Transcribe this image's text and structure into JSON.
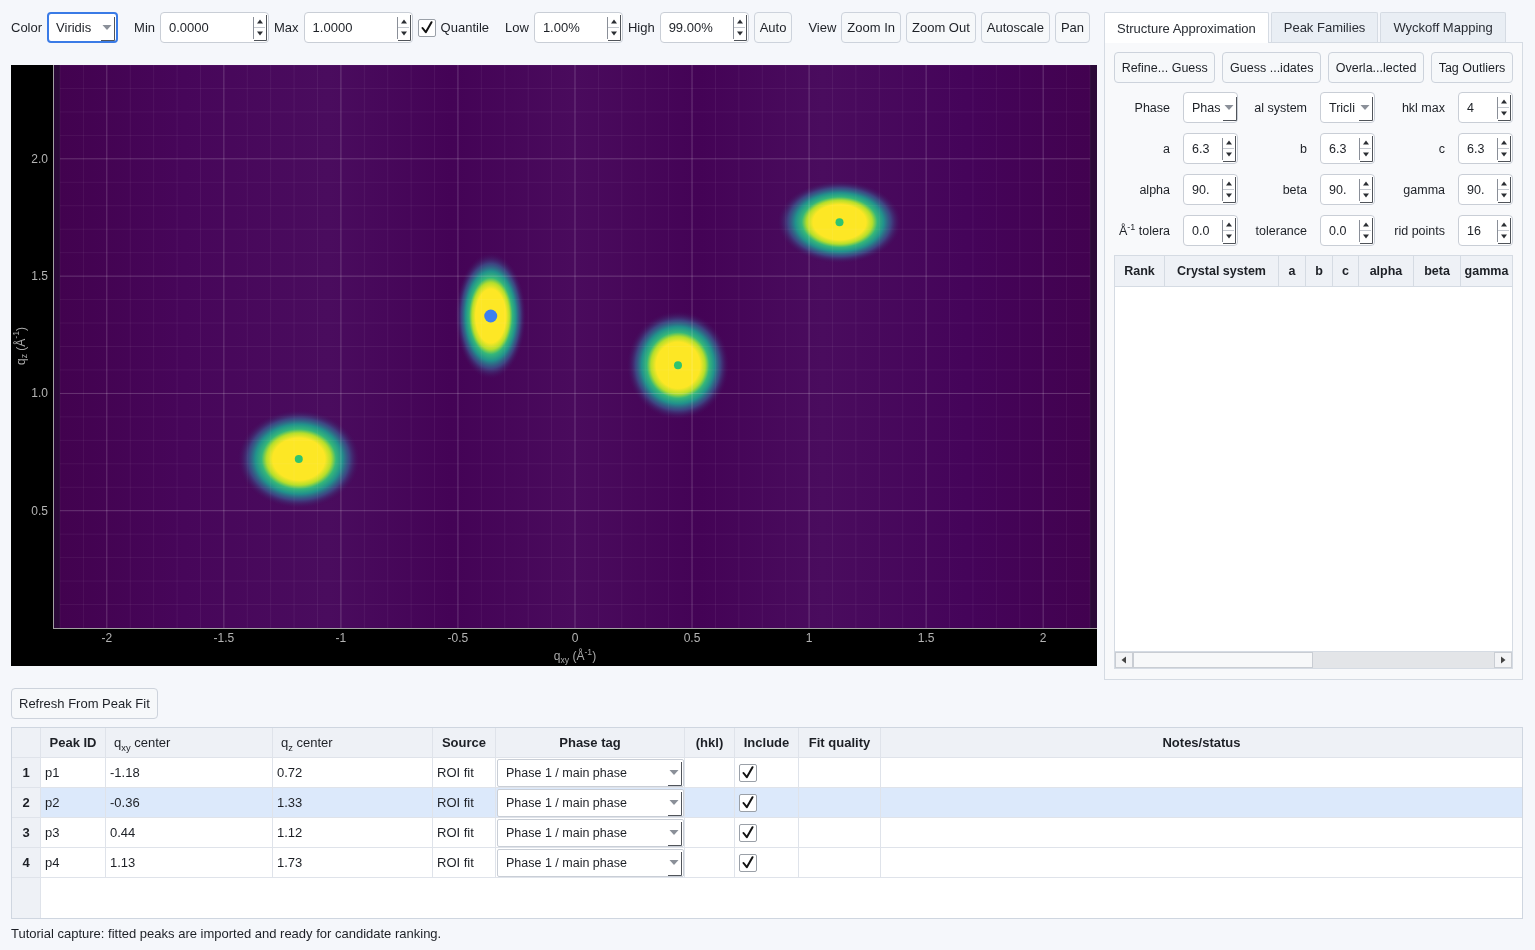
{
  "toolbar": {
    "groups": [
      {
        "items": [
          {
            "kind": "label",
            "text": "Color"
          },
          {
            "kind": "combo",
            "value": "Viridis",
            "focused": true
          }
        ]
      },
      {
        "items": [
          {
            "kind": "label",
            "text": "Min"
          },
          {
            "kind": "spin",
            "value": "0.0000"
          },
          {
            "kind": "label",
            "text": "Max"
          },
          {
            "kind": "spin",
            "value": "1.0000"
          },
          {
            "kind": "check",
            "checked": true
          },
          {
            "kind": "label",
            "text": "Quantile"
          }
        ]
      },
      {
        "items": [
          {
            "kind": "label",
            "text": "Low"
          },
          {
            "kind": "spin",
            "value": "1.00%"
          },
          {
            "kind": "label",
            "text": "High"
          },
          {
            "kind": "spin",
            "value": "99.00%"
          },
          {
            "kind": "button",
            "text": "Auto"
          }
        ]
      },
      {
        "items": [
          {
            "kind": "label",
            "text": "View"
          },
          {
            "kind": "button",
            "text": "Zoom In"
          },
          {
            "kind": "button",
            "text": "Zoom Out"
          },
          {
            "kind": "button",
            "text": "Autoscale"
          },
          {
            "kind": "button",
            "text": "Pan"
          }
        ]
      }
    ]
  },
  "plot": {
    "chart_data": {
      "type": "scatter",
      "xlabel": "q$_{xy}$ (Å$^{-1}$)",
      "ylabel": "q$_{z}$ (Å$^{-1}$)",
      "xlim": [
        -2.23,
        2.23
      ],
      "ylim": [
        0,
        2.4
      ],
      "xticks": [
        -2,
        -1.5,
        -1,
        -0.5,
        0,
        0.5,
        1,
        1.5,
        2
      ],
      "yticks": [
        {
          "value": 0.5,
          "label": "0.5"
        },
        {
          "value": 1,
          "label": "1.0"
        },
        {
          "value": 1.5,
          "label": "1.5"
        },
        {
          "value": 2,
          "label": "2.0"
        }
      ],
      "grid": true,
      "x": [
        -1.18,
        -0.36,
        0.44,
        1.13
      ],
      "series": [
        {
          "color": "#2fc46f",
          "values": [
            0.72,
            null,
            1.12,
            1.73
          ]
        },
        {
          "color": "#3b7ff0",
          "values": [
            null,
            1.33,
            null,
            null
          ]
        }
      ]
    }
  },
  "tabs": [
    {
      "label": "Structure Approximation",
      "selected": true
    },
    {
      "label": "Peak Families",
      "selected": false
    },
    {
      "label": "Wyckoff Mapping",
      "selected": false
    }
  ],
  "structure_panel": {
    "buttons": [
      "Refine... Guess",
      "Guess ...idates",
      "Overla...lected",
      "Tag Outliers"
    ],
    "parameters": [
      {
        "label": "Phase",
        "kind": "combo",
        "value": "Phas"
      },
      {
        "label": "al system",
        "kind": "combo",
        "value": "Tricli"
      },
      {
        "label": "hkl max",
        "kind": "spin",
        "value": "4"
      },
      {
        "label": "a",
        "kind": "spin",
        "value": "6.3"
      },
      {
        "label": "b",
        "kind": "spin",
        "value": "6.3"
      },
      {
        "label": "c",
        "kind": "spin",
        "value": "6.3"
      },
      {
        "label": "alpha",
        "kind": "spin",
        "value": "90."
      },
      {
        "label": "beta",
        "kind": "spin",
        "value": "90."
      },
      {
        "label": "gamma",
        "kind": "spin",
        "value": "90."
      },
      {
        "label": "Å$^{-1}$ tolera",
        "kind": "spin",
        "value": "0.0"
      },
      {
        "label": "tolerance",
        "kind": "spin",
        "value": "0.0"
      },
      {
        "label": "rid points",
        "kind": "spin",
        "value": "16"
      }
    ],
    "candidates_table": {
      "columns": [
        "Rank",
        "Crystal system",
        "a",
        "b",
        "c",
        "alpha",
        "beta",
        "gamma"
      ]
    }
  },
  "refresh_button": "Refresh From Peak Fit",
  "peak_table": {
    "columns": [
      {
        "label": "Peak ID",
        "kind": "plain"
      },
      {
        "label": "q$_{xy}$ center",
        "kind": "rich"
      },
      {
        "label": "q$_{z}$ center",
        "kind": "rich"
      },
      {
        "label": "Source",
        "kind": "plain"
      },
      {
        "label": "Phase tag",
        "kind": "plain"
      },
      {
        "label": "(hkl)",
        "kind": "plain"
      },
      {
        "label": "Include",
        "kind": "plain"
      },
      {
        "label": "Fit quality",
        "kind": "plain"
      },
      {
        "label": "Notes/status",
        "kind": "plain"
      }
    ],
    "rows": [
      {
        "number": "1",
        "peak_id": "p1",
        "qxy_center": "-1.18",
        "qz_center": "0.72",
        "source": "ROI fit",
        "phase_tag": "Phase 1 / main phase",
        "include": true,
        "selected": false
      },
      {
        "number": "2",
        "peak_id": "p2",
        "qxy_center": "-0.36",
        "qz_center": "1.33",
        "source": "ROI fit",
        "phase_tag": "Phase 1 / main phase",
        "include": true,
        "selected": true
      },
      {
        "number": "3",
        "peak_id": "p3",
        "qxy_center": "0.44",
        "qz_center": "1.12",
        "source": "ROI fit",
        "phase_tag": "Phase 1 / main phase",
        "include": true,
        "selected": false
      },
      {
        "number": "4",
        "peak_id": "p4",
        "qxy_center": "1.13",
        "qz_center": "1.73",
        "source": "ROI fit",
        "phase_tag": "Phase 1 / main phase",
        "include": true,
        "selected": false
      }
    ]
  },
  "status_bar": "Tutorial capture: fitted peaks are imported and ready for candidate ranking."
}
